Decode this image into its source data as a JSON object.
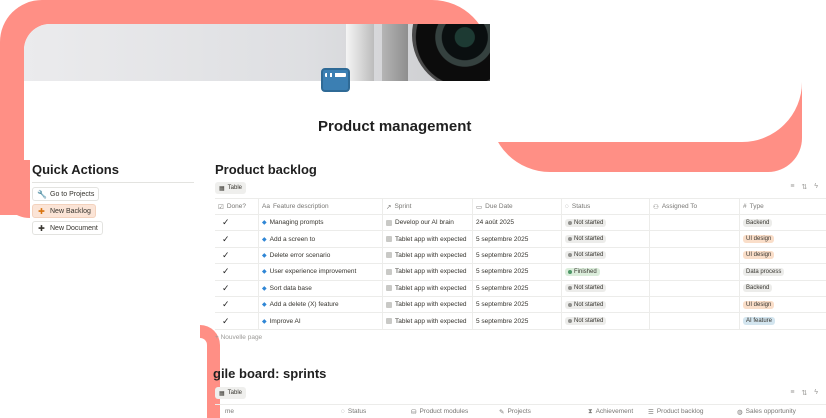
{
  "page": {
    "title": "Product management"
  },
  "quick_actions": {
    "title": "Quick Actions",
    "buttons": [
      {
        "label": "Go to Projects",
        "icon": "wrench-icon"
      },
      {
        "label": "New Backlog",
        "icon": "plus-icon"
      },
      {
        "label": "New Document",
        "icon": "plus-icon"
      }
    ]
  },
  "backlog": {
    "title": "Product backlog",
    "view": "Table",
    "columns": [
      "Done?",
      "Feature description",
      "Sprint",
      "Due Date",
      "Status",
      "Assigned To",
      "Type"
    ],
    "rows": [
      {
        "done": "✓",
        "feature": "Managing prompts",
        "sprint": "Develop our AI brain",
        "due": "24 août 2025",
        "status": "Not started",
        "assigned": "",
        "type": "Backend"
      },
      {
        "done": "✓",
        "feature": "Add a screen to",
        "sprint": "Tablet app with expected",
        "due": "5 septembre 2025",
        "status": "Not started",
        "assigned": "",
        "type": "UI design"
      },
      {
        "done": "✓",
        "feature": "Delete error scenario",
        "sprint": "Tablet app with expected",
        "due": "5 septembre 2025",
        "status": "Not started",
        "assigned": "",
        "type": "UI design"
      },
      {
        "done": "✓",
        "feature": "User experience improvement",
        "sprint": "Tablet app with expected",
        "due": "5 septembre 2025",
        "status": "Finished",
        "assigned": "",
        "type": "Data process"
      },
      {
        "done": "✓",
        "feature": "Sort data base",
        "sprint": "Tablet app with expected",
        "due": "5 septembre 2025",
        "status": "Not started",
        "assigned": "",
        "type": "Backend"
      },
      {
        "done": "✓",
        "feature": "Add a delete (X) feature",
        "sprint": "Tablet app with expected",
        "due": "5 septembre 2025",
        "status": "Not started",
        "assigned": "",
        "type": "UI design"
      },
      {
        "done": "✓",
        "feature": "Improve AI",
        "sprint": "Tablet app with expected",
        "due": "5 septembre 2025",
        "status": "Not started",
        "assigned": "",
        "type": "AI feature"
      }
    ],
    "new_page_label": "Nouvelle page"
  },
  "sprints": {
    "title": "gile board: sprints",
    "view": "Table",
    "columns": [
      "Status",
      "Product modules",
      "Projects",
      "Achievement",
      "Product backlog",
      "Sales opportunity"
    ]
  },
  "colors": {
    "accent_decoration": "#ff8f85",
    "status_not_started_bg": "#ececea",
    "status_finished_bg": "#dbeddb",
    "type_backend_bg": "#ececea",
    "type_ui_design_bg": "#fadec9",
    "type_data_process_bg": "#ececea",
    "type_ai_feature_bg": "#d3e5ef"
  }
}
